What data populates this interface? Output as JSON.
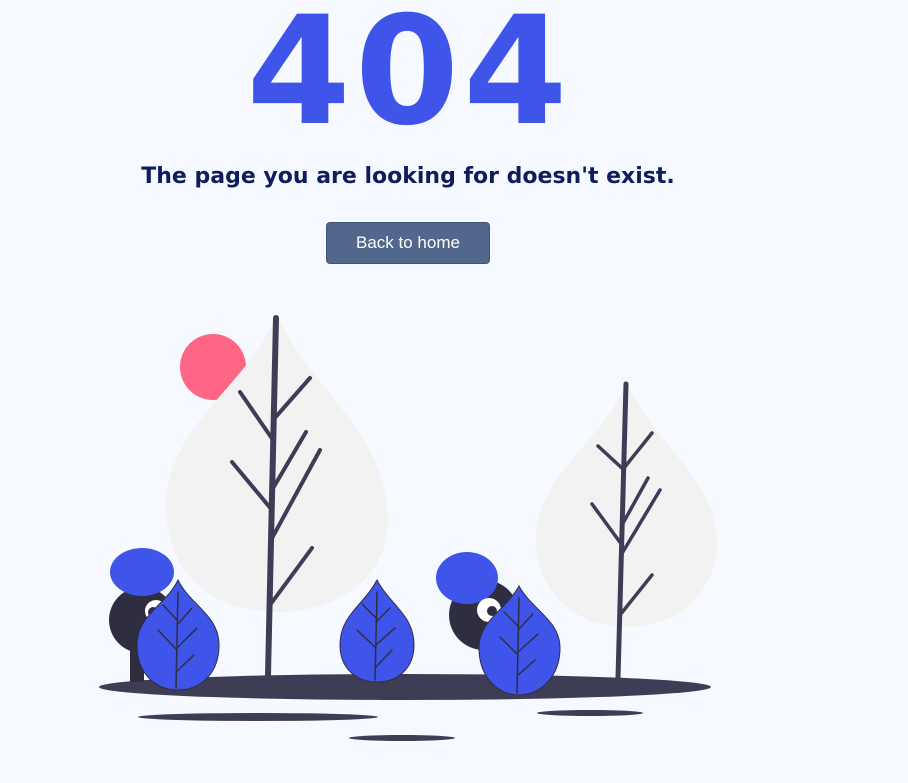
{
  "error": {
    "code": "404",
    "message": "The page you are looking for doesn't exist."
  },
  "actions": {
    "back_home_label": "Back to home"
  },
  "colors": {
    "background": "#f6f9ff",
    "accent_blue": "#3f55ea",
    "heading_navy": "#0f1d5c",
    "button_bg": "#51688c",
    "sun_pink": "#ff6584",
    "trunk_dark": "#3f3d56",
    "tree_canopy": "#f2f2f2"
  },
  "illustration": {
    "icon": "trees-and-characters-illustration"
  }
}
